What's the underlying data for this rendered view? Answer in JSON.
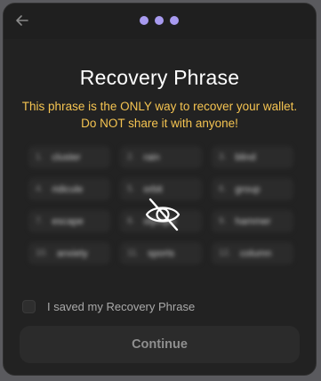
{
  "header": {
    "back_icon": "arrow-left-icon",
    "steps": [
      {
        "state": "active"
      },
      {
        "state": "active"
      },
      {
        "state": "active"
      }
    ],
    "step_color": "#a89bf0"
  },
  "main": {
    "title": "Recovery Phrase",
    "warning": "This phrase is the ONLY way to recover your wallet. Do NOT share it with anyone!",
    "warning_color": "#f5c451",
    "words": [
      {
        "num": "1.",
        "word": "cluster"
      },
      {
        "num": "2.",
        "word": "rain"
      },
      {
        "num": "3.",
        "word": "blind"
      },
      {
        "num": "4.",
        "word": "ridicule"
      },
      {
        "num": "5.",
        "word": "orbit"
      },
      {
        "num": "6.",
        "word": "group"
      },
      {
        "num": "7.",
        "word": "escape"
      },
      {
        "num": "8.",
        "word": "olympic"
      },
      {
        "num": "9.",
        "word": "hammer"
      },
      {
        "num": "10.",
        "word": "anxiety"
      },
      {
        "num": "11.",
        "word": "sports"
      },
      {
        "num": "12.",
        "word": "column"
      }
    ],
    "reveal_icon": "eye-off-icon"
  },
  "footer": {
    "saved_label": "I saved my Recovery Phrase",
    "saved_checked": false,
    "continue_label": "Continue"
  }
}
